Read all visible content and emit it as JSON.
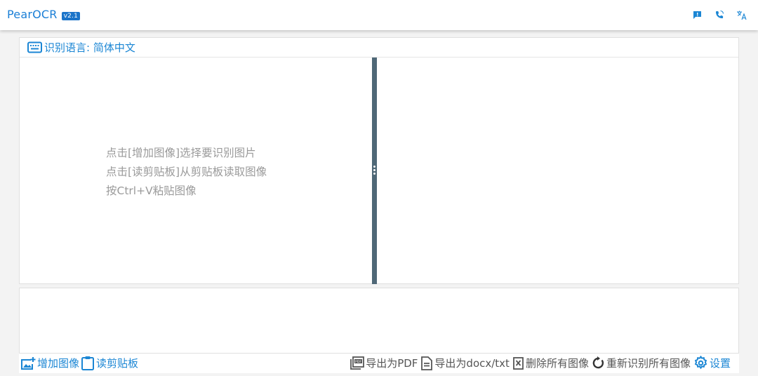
{
  "header": {
    "title": "PearOCR",
    "version": "v2.1",
    "icons": [
      "feedback-icon",
      "phone-icon",
      "translate-icon"
    ]
  },
  "language_bar": {
    "label": "识别语言: 简体中文",
    "icon": "keyboard-icon"
  },
  "hints": {
    "line1": "点击[增加图像]选择要识别图片",
    "line2": "点击[读剪贴板]从剪贴板读取图像",
    "line3": "按Ctrl+V粘贴图像"
  },
  "toolbar": {
    "add_image": "增加图像",
    "read_clipboard": "读剪贴板",
    "export_pdf": "导出为PDF",
    "export_docx": "导出为docx/txt",
    "delete_all": "删除所有图像",
    "reocr_all": "重新识别所有图像",
    "settings": "设置"
  },
  "colors": {
    "accent": "#1b86d4",
    "divider": "#4f6877",
    "hint_text": "#9a9a9a"
  }
}
